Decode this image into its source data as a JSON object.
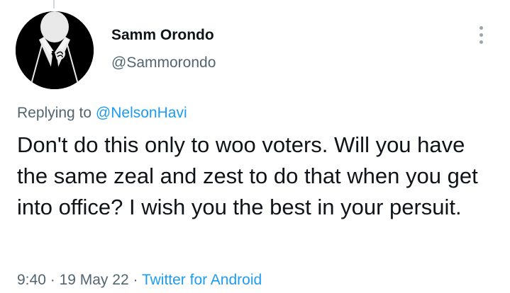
{
  "author": {
    "name": "Samm Orondo",
    "handle": "@Sammorondo",
    "avatar_icon": "suit-tie-silhouette-avatar"
  },
  "reply": {
    "prefix": "Replying to",
    "mention": "@NelsonHavi"
  },
  "tweet": {
    "text": "Don't do this only to woo voters. Will you have the same zeal and zest to do that when you get into office? I wish you the best in your persuit."
  },
  "meta": {
    "time": "9:40",
    "separator": "·",
    "date": "19 May 22",
    "source": "Twitter for Android"
  },
  "menu": {
    "icon": "more-vertical-icon"
  },
  "colors": {
    "text": "#0f1419",
    "muted": "#536471",
    "link": "#1d9bf0"
  }
}
